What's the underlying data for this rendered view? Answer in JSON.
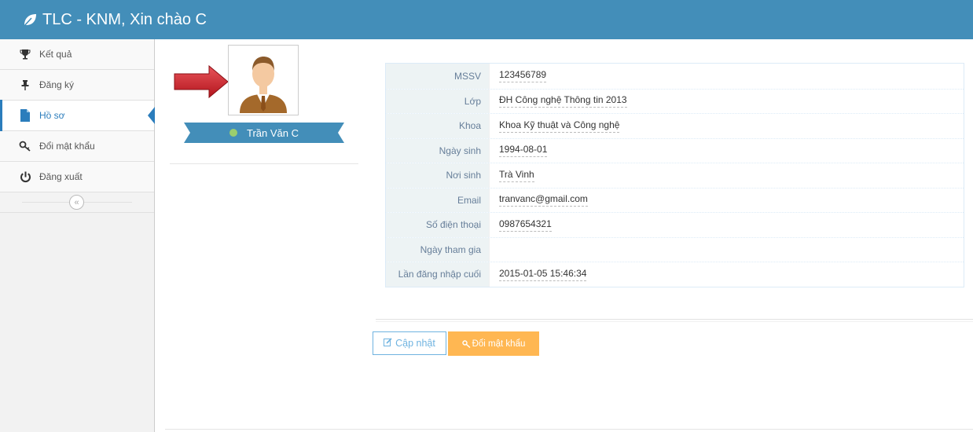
{
  "navbar": {
    "title": "TLC - KNM, Xin chào C",
    "icon": "leaf-icon"
  },
  "sidebar": {
    "items": [
      {
        "label": "Kết quả",
        "icon": "trophy-icon"
      },
      {
        "label": "Đăng ký",
        "icon": "pushpin-icon"
      },
      {
        "label": "Hồ sơ",
        "icon": "file-icon",
        "active": true
      },
      {
        "label": "Đổi mật khẩu",
        "icon": "key-icon"
      },
      {
        "label": "Đăng xuất",
        "icon": "power-icon"
      }
    ],
    "collapse_icon": "double-chevron-left-icon"
  },
  "profile": {
    "name": "Trần Văn C",
    "status_color": "#9bce6e"
  },
  "info": {
    "rows": [
      {
        "label": "MSSV",
        "value": "123456789"
      },
      {
        "label": "Lớp",
        "value": "ĐH Công nghệ Thông tin 2013"
      },
      {
        "label": "Khoa",
        "value": "Khoa Kỹ thuật và Công nghệ"
      },
      {
        "label": "Ngày sinh",
        "value": "1994-08-01"
      },
      {
        "label": "Nơi sinh",
        "value": "Trà Vinh"
      },
      {
        "label": "Email",
        "value": "tranvanc@gmail.com"
      },
      {
        "label": "Số điện thoại",
        "value": "0987654321"
      },
      {
        "label": "Ngày tham gia",
        "value": ""
      },
      {
        "label": "Lần đăng nhập cuối",
        "value": "2015-01-05 15:46:34"
      }
    ]
  },
  "actions": {
    "update_label": "Cập nhật",
    "change_password_label": "Đổi mật khẩu"
  },
  "colors": {
    "navbar": "#438eb9",
    "accent": "#2b7dbc",
    "warning": "#ffb752",
    "ribbon": "#438eb9"
  }
}
